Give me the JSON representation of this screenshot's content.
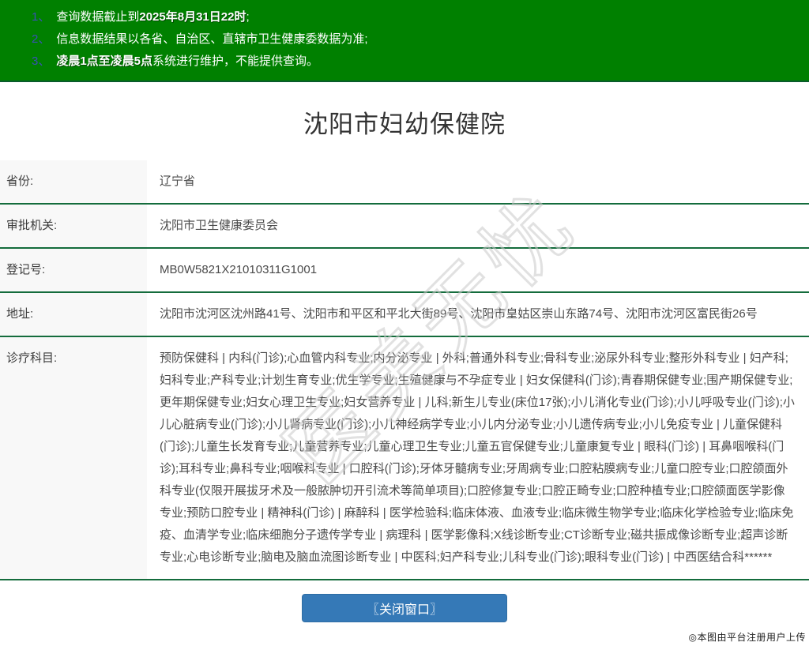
{
  "notices": {
    "background_color": "#008000",
    "number_color": "#3a50b5",
    "text_color": "#ffffff",
    "items": [
      {
        "num": "1、",
        "pre": "查询数据截止到",
        "bold": "2025年8月31日22时",
        "post": ";"
      },
      {
        "num": "2、",
        "pre": "信息数据结果以各省、自治区、直辖市卫生健康委数据为准;",
        "bold": "",
        "post": ""
      },
      {
        "num": "3、",
        "pre": "",
        "bold": "凌晨1点至凌晨5点",
        "post": "系统进行维护，不能提供查询。"
      }
    ]
  },
  "page": {
    "title": "沈阳市妇幼保健院"
  },
  "details": {
    "separator_color": "#146c3c",
    "label_background": "#f8f8f8",
    "rows": [
      {
        "label": "省份:",
        "value": "辽宁省"
      },
      {
        "label": "审批机关:",
        "value": "沈阳市卫生健康委员会"
      },
      {
        "label": "登记号:",
        "value": "MB0W5821X21010311G1001"
      },
      {
        "label": "地址:",
        "value": "沈阳市沈河区沈州路41号、沈阳市和平区和平北大街89号、沈阳市皇姑区崇山东路74号、沈阳市沈河区富民街26号"
      },
      {
        "label": "诊疗科目:",
        "value": "预防保健科 | 内科(门诊);心血管内科专业;内分泌专业 | 外科;普通外科专业;骨科专业;泌尿外科专业;整形外科专业 | 妇产科;妇科专业;产科专业;计划生育专业;优生学专业;生殖健康与不孕症专业 | 妇女保健科(门诊);青春期保健专业;围产期保健专业;更年期保健专业;妇女心理卫生专业;妇女营养专业 | 儿科;新生儿专业(床位17张);小儿消化专业(门诊);小儿呼吸专业(门诊);小儿心脏病专业(门诊);小儿肾病专业(门诊);小儿神经病学专业;小儿内分泌专业;小儿遗传病专业;小儿免疫专业 | 儿童保健科(门诊);儿童生长发育专业;儿童营养专业;儿童心理卫生专业;儿童五官保健专业;儿童康复专业 | 眼科(门诊) | 耳鼻咽喉科(门诊);耳科专业;鼻科专业;咽喉科专业 | 口腔科(门诊);牙体牙髓病专业;牙周病专业;口腔粘膜病专业;儿童口腔专业;口腔颌面外科专业(仅限开展拔牙术及一般脓肿切开引流术等简单项目);口腔修复专业;口腔正畸专业;口腔种植专业;口腔颌面医学影像专业;预防口腔专业 | 精神科(门诊) | 麻醉科 | 医学检验科;临床体液、血液专业;临床微生物学专业;临床化学检验专业;临床免疫、血清学专业;临床细胞分子遗传学专业 | 病理科 | 医学影像科;X线诊断专业;CT诊断专业;磁共振成像诊断专业;超声诊断专业;心电诊断专业;脑电及脑血流图诊断专业 | 中医科;妇产科专业;儿科专业(门诊);眼科专业(门诊) | 中西医结合科******"
      }
    ]
  },
  "footer": {
    "close_button": "〖关闭窗口〗",
    "button_color": "#3579b7",
    "upload_note": "◎本图由平台注册用户上传"
  },
  "watermark": {
    "text": "医美无忧"
  }
}
